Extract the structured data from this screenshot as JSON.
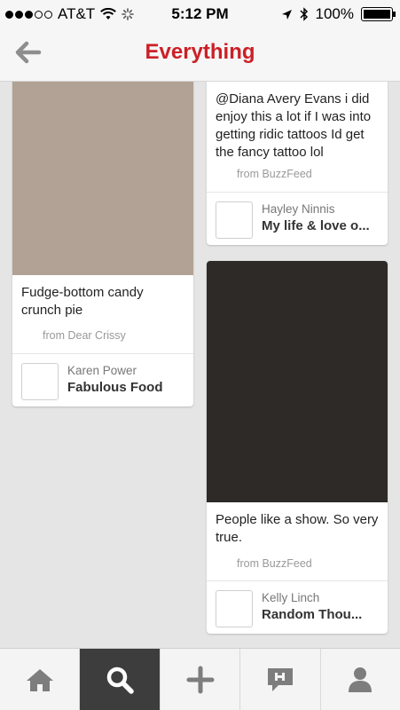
{
  "status_bar": {
    "carrier": "AT&T",
    "time": "5:12 PM",
    "battery": "100%",
    "battery_level": 1.0,
    "signal_bars_filled": 3,
    "signal_bars_total": 5
  },
  "header": {
    "title": "Everything",
    "title_color": "#cb2027",
    "back_icon": "back-arrow-icon"
  },
  "pins": [
    {
      "image_color": "#b1a295",
      "description": "Fudge-bottom candy crunch pie",
      "source": "from Dear Crissy",
      "user": "Karen Power",
      "board": "Fabulous Food"
    },
    {
      "description": "@Diana Avery Evans i did enjoy this a lot if I was into getting ridic tattoos Id get the fancy tattoo lol",
      "source": "from BuzzFeed",
      "user": "Hayley Ninnis",
      "board": "My life & love o..."
    },
    {
      "image_color": "#2d2a27",
      "description": "People like a show. So very true.",
      "source": "from BuzzFeed",
      "user": "Kelly Linch",
      "board": "Random Thou..."
    }
  ],
  "tabbar": {
    "items": [
      {
        "icon": "home-icon",
        "active": false
      },
      {
        "icon": "search-icon",
        "active": true
      },
      {
        "icon": "add-icon",
        "active": false
      },
      {
        "icon": "news-icon",
        "active": false
      },
      {
        "icon": "profile-icon",
        "active": false
      }
    ]
  }
}
